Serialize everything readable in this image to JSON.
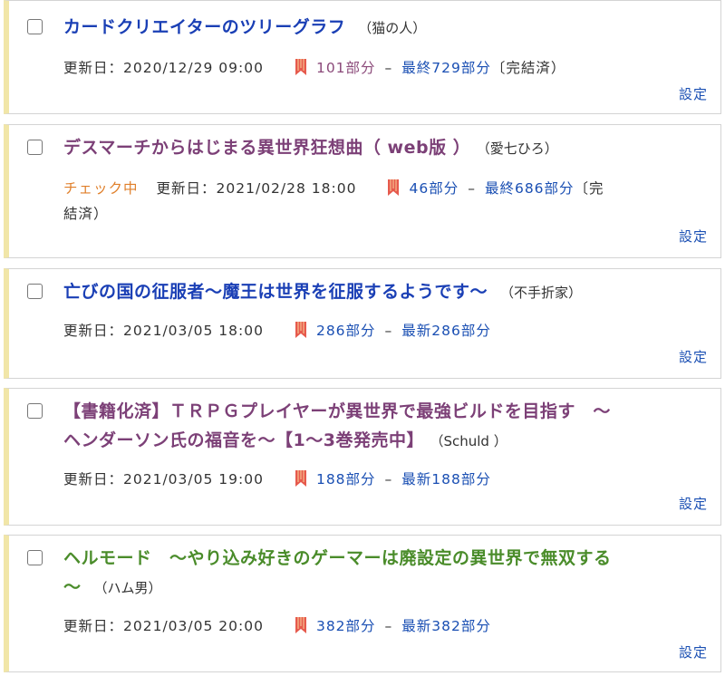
{
  "items": [
    {
      "title": "カードクリエイターのツリーグラフ",
      "author": "（猫の人）",
      "title_color": "#1a3fb5",
      "check_status": "",
      "update_label": "更新日：",
      "update_time": "2020/12/29 09:00",
      "parts": "101部分",
      "parts_color": "#8b4a7a",
      "sep": "–",
      "latest": "最終729部分",
      "complete": "〔完結済）",
      "settings": "設定"
    },
    {
      "title": "デスマーチからはじまる異世界狂想曲（ web版 ）",
      "author": "（愛七ひろ）",
      "title_color": "#7c4077",
      "check_status": "チェック中",
      "update_label": "更新日：",
      "update_time": "2021/02/28 18:00",
      "parts": "46部分",
      "parts_color": "#1a4fb3",
      "sep": "–",
      "latest": "最終686部分",
      "complete_part1": "〔完",
      "complete_part2": "結済）",
      "settings": "設定"
    },
    {
      "title": "亡びの国の征服者〜魔王は世界を征服するようです〜",
      "author": "（不手折家）",
      "title_color": "#1a3fb5",
      "check_status": "",
      "update_label": "更新日：",
      "update_time": "2021/03/05 18:00",
      "parts": "286部分",
      "parts_color": "#1a4fb3",
      "sep": "–",
      "latest": "最新286部分",
      "settings": "設定"
    },
    {
      "title_line1": "【書籍化済】ＴＲＰＧプレイヤーが異世界で最強ビルドを目指す　〜",
      "title_line2": "ヘンダーソン氏の福音を〜【1〜3巻発売中】",
      "author": "（Schuld ）",
      "title_color": "#7c4077",
      "update_label": "更新日：",
      "update_time": "2021/03/05 19:00",
      "parts": "188部分",
      "parts_color": "#1a4fb3",
      "sep": "–",
      "latest": "最新188部分",
      "settings": "設定"
    },
    {
      "title_line1": "ヘルモード　〜やり込み好きのゲーマーは廃設定の異世界で無双する",
      "title_line2": "〜",
      "author": "（ハム男）",
      "title_color": "#4a8c2a",
      "update_label": "更新日：",
      "update_time": "2021/03/05 20:00",
      "parts": "382部分",
      "parts_color": "#1a4fb3",
      "sep": "–",
      "latest": "最新382部分",
      "settings": "設定"
    }
  ]
}
